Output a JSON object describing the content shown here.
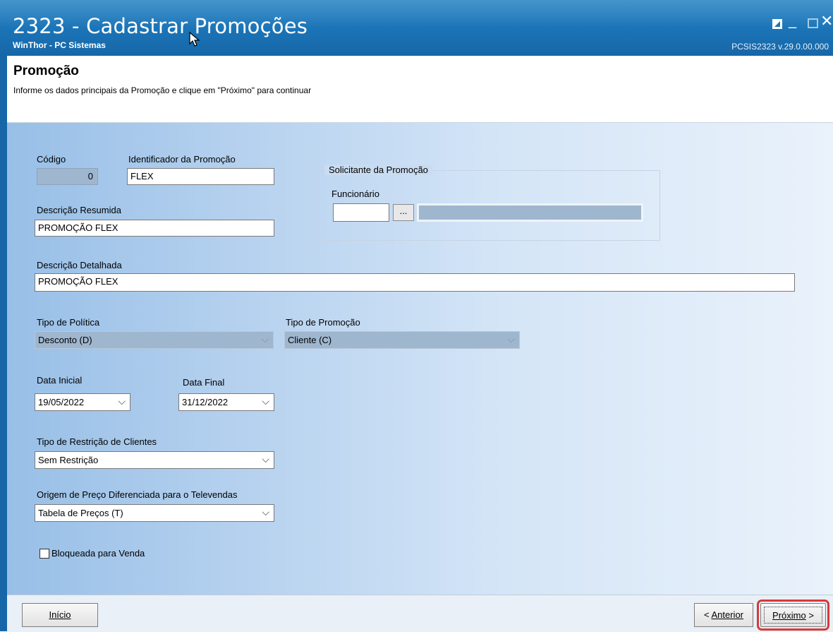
{
  "window": {
    "title": "2323 - Cadastrar Promoções",
    "subtitle": "WinThor - PC Sistemas",
    "version": "PCSIS2323  v.29.0.00.000"
  },
  "header": {
    "title": "Promoção",
    "instruction": "Informe os dados principais da Promoção e clique em \"Próximo\" para continuar"
  },
  "form": {
    "codigo": {
      "label": "Código",
      "value": "0"
    },
    "identificador": {
      "label": "Identificador da Promoção",
      "value": "FLEX"
    },
    "descricao_resumida": {
      "label": "Descrição Resumida",
      "value": "PROMOÇÃO FLEX"
    },
    "solicitante": {
      "legend": "Solicitante da Promoção",
      "funcionario_label": "Funcionário",
      "funcionario_code": "",
      "funcionario_name": "",
      "lookup_label": "..."
    },
    "descricao_detalhada": {
      "label": "Descrição Detalhada",
      "value": "PROMOÇÃO FLEX"
    },
    "tipo_politica": {
      "label": "Tipo de Política",
      "value": "Desconto (D)"
    },
    "tipo_promocao": {
      "label": "Tipo de Promoção",
      "value": "Cliente (C)"
    },
    "data_inicial": {
      "label": "Data Inicial",
      "value": "19/05/2022"
    },
    "data_final": {
      "label": "Data Final",
      "value": "31/12/2022"
    },
    "tipo_restricao": {
      "label": "Tipo de Restrição de Clientes",
      "value": "Sem Restrição"
    },
    "origem_preco": {
      "label": "Origem de Preço Diferenciada para o Televendas",
      "value": "Tabela de Preços (T)"
    },
    "bloqueada": {
      "label": "Bloqueada para Venda",
      "checked": false
    }
  },
  "footer": {
    "inicio_label": "Início",
    "anterior_prefix": "< ",
    "anterior_label": "Anterior",
    "proximo_label": "Próximo",
    "proximo_suffix": " >"
  },
  "icons": {
    "chevron": "chevron-down-icon",
    "cursor": "mouse-cursor-icon"
  },
  "colors": {
    "titlebar": "#1a73b6",
    "highlight": "#d63a3a"
  }
}
